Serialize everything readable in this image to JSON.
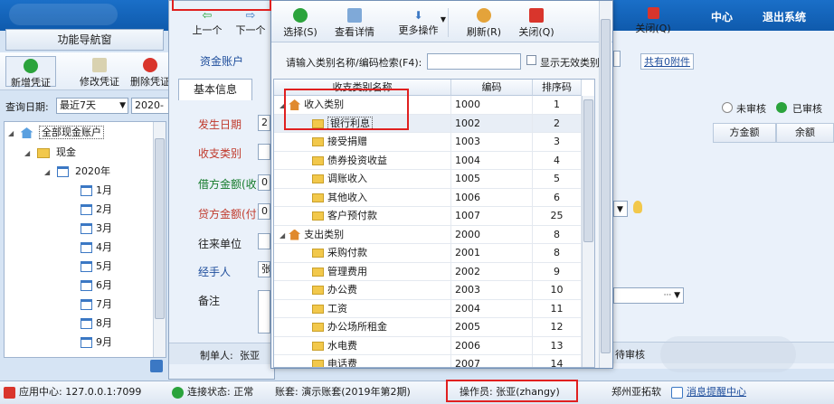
{
  "topbar": {
    "menu_center": "中心",
    "menu_exit": "退出系统"
  },
  "nav": {
    "title": "功能导航窗"
  },
  "left_toolbar": {
    "new_voucher": "新增凭证",
    "edit_voucher": "修改凭证",
    "delete_voucher": "删除凭证"
  },
  "date_filter": {
    "label": "查询日期:",
    "range": "最近7天",
    "start": "2020-09-"
  },
  "tree": {
    "root": "全部现金账户",
    "cash": "现金",
    "year": "2020年",
    "months": [
      "1月",
      "2月",
      "3月",
      "4月",
      "5月",
      "6月",
      "7月",
      "8月",
      "9月"
    ]
  },
  "mid_toolbar": {
    "prev": "上一个",
    "next": "下一个"
  },
  "form": {
    "account_label": "资金账户",
    "tab_basic": "基本信息",
    "date_label": "发生日期",
    "date_value": "2",
    "category_label": "收支类别",
    "debit_label": "借方金额(收)",
    "debit_value": "0",
    "credit_label": "贷方金额(付)",
    "credit_value": "0",
    "partner_label": "往来单位",
    "handler_label": "经手人",
    "handler_value": "张",
    "remark_label": "备注",
    "maker_label": "制单人:",
    "maker_value": "张亚"
  },
  "dialog": {
    "toolbar": {
      "select": "选择(S)",
      "view_detail": "查看详情",
      "more_ops": "更多操作",
      "refresh": "刷新(R)",
      "close": "关闭(Q)"
    },
    "search_label": "请输入类别名称/编码检索(F4):",
    "search_value": "",
    "show_invalid": "显示无效类别",
    "columns": [
      "收支类别名称",
      "编码",
      "排序码"
    ],
    "rows": [
      {
        "name": "收入类别",
        "code": "1000",
        "sort": "1",
        "level": 0,
        "home": true
      },
      {
        "name": "银行利息",
        "code": "1002",
        "sort": "2",
        "level": 1
      },
      {
        "name": "接受捐赠",
        "code": "1003",
        "sort": "3",
        "level": 1
      },
      {
        "name": "债券投资收益",
        "code": "1004",
        "sort": "4",
        "level": 1
      },
      {
        "name": "调账收入",
        "code": "1005",
        "sort": "5",
        "level": 1
      },
      {
        "name": "其他收入",
        "code": "1006",
        "sort": "6",
        "level": 1
      },
      {
        "name": "客户预付款",
        "code": "1007",
        "sort": "25",
        "level": 1
      },
      {
        "name": "支出类别",
        "code": "2000",
        "sort": "8",
        "level": 0,
        "home": true
      },
      {
        "name": "采购付款",
        "code": "2001",
        "sort": "8",
        "level": 1
      },
      {
        "name": "管理费用",
        "code": "2002",
        "sort": "9",
        "level": 1
      },
      {
        "name": "办公费",
        "code": "2003",
        "sort": "10",
        "level": 1
      },
      {
        "name": "工资",
        "code": "2004",
        "sort": "11",
        "level": 1
      },
      {
        "name": "办公场所租金",
        "code": "2005",
        "sort": "12",
        "level": 1
      },
      {
        "name": "水电费",
        "code": "2006",
        "sort": "13",
        "level": 1
      },
      {
        "name": "电话费",
        "code": "2007",
        "sort": "14",
        "level": 1
      }
    ]
  },
  "right": {
    "close": "关闭(Q)",
    "attachment": "共有0附件",
    "unaudited": "未审核",
    "audited": "已审核",
    "col_credit": "方金额",
    "col_balance": "余额",
    "pending": "待审核"
  },
  "statusbar": {
    "app_center": "应用中心: 127.0.0.1:7099",
    "connection": "连接状态: 正常",
    "book": "账套: 演示账套(2019年第2期)",
    "operator": "操作员: 张亚(zhangy)",
    "company": "郑州亚拓软",
    "message": "消息提醒中心"
  },
  "colors": {
    "topbar": "#1a6fc8",
    "highlight_red": "#e02020",
    "label_red": "#c0392b",
    "label_blue": "#1f4e9c",
    "label_green": "#137a2a"
  }
}
